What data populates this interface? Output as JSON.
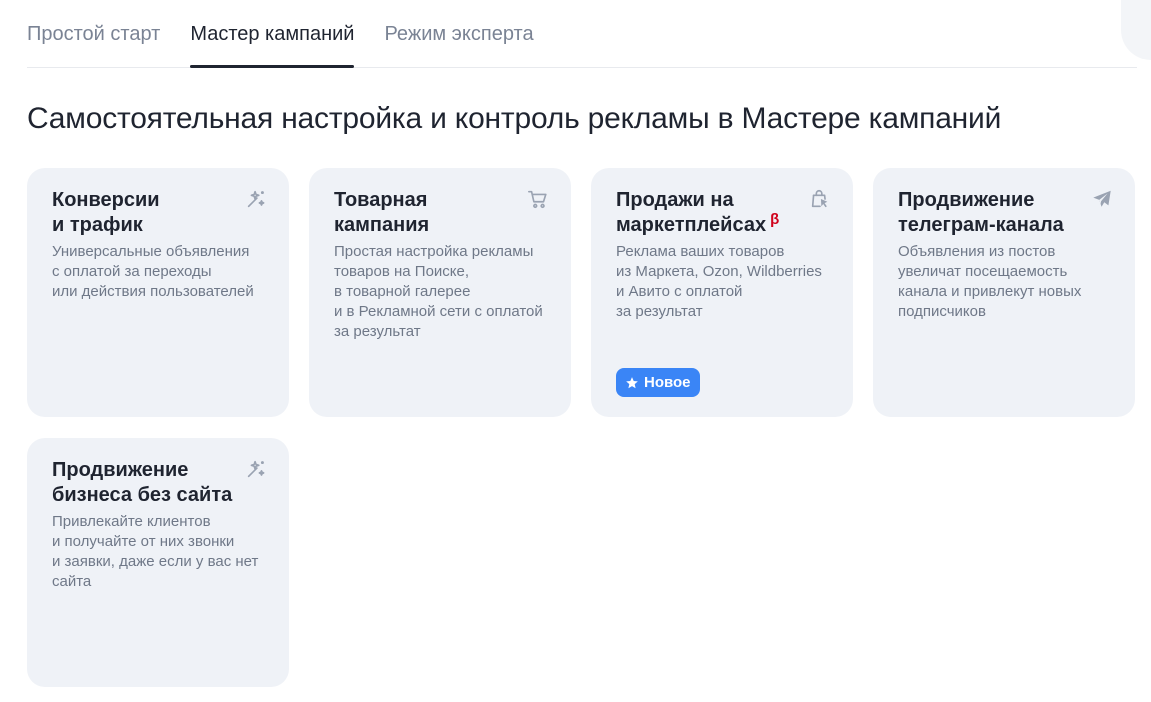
{
  "tabs": [
    {
      "label": "Простой старт",
      "active": false
    },
    {
      "label": "Мастер кампаний",
      "active": true
    },
    {
      "label": "Режим эксперта",
      "active": false
    }
  ],
  "page_title": "Самостоятельная настройка и контроль рекламы в Мастере кампаний",
  "cards": [
    {
      "title_lines": [
        "Конверсии",
        "и трафик"
      ],
      "description_lines": [
        "Универсальные объявления",
        "с оплатой за переходы",
        "или действия пользователей"
      ],
      "icon": "magic-wand-icon"
    },
    {
      "title_lines": [
        "Товарная",
        "кампания"
      ],
      "description_lines": [
        "Простая настройка рекламы",
        "товаров на Поиске,",
        "в товарной галерее",
        "и в Рекламной сети с оплатой",
        "за результат"
      ],
      "icon": "shopping-cart-icon"
    },
    {
      "title_lines": [
        "Продажи на",
        "маркетплейсах"
      ],
      "beta": "β",
      "description_lines": [
        "Реклама ваших товаров",
        "из Маркета, Ozon, Wildberries",
        "и Авито с оплатой",
        "за результат"
      ],
      "icon": "shopping-bag-cursor-icon",
      "badge": {
        "label": "Новое",
        "icon": "star-icon"
      }
    },
    {
      "title_lines": [
        "Продвижение",
        "телеграм-канала"
      ],
      "description_lines": [
        "Объявления из постов",
        "увеличат посещаемость",
        "канала и привлекут новых",
        "подписчиков"
      ],
      "icon": "paper-plane-icon"
    },
    {
      "title_lines": [
        "Продвижение",
        "бизнеса без сайта"
      ],
      "description_lines": [
        "Привлекайте клиентов",
        "и получайте от них звонки",
        "и заявки, даже если у вас нет",
        "сайта"
      ],
      "icon": "magic-wand-icon"
    }
  ],
  "colors": {
    "card_bg": "#eff2f7",
    "text_primary": "#1f2430",
    "text_secondary": "#6f7888",
    "icon": "#9aa3b2",
    "badge_bg": "#3a85f6",
    "beta": "#d0021b"
  }
}
